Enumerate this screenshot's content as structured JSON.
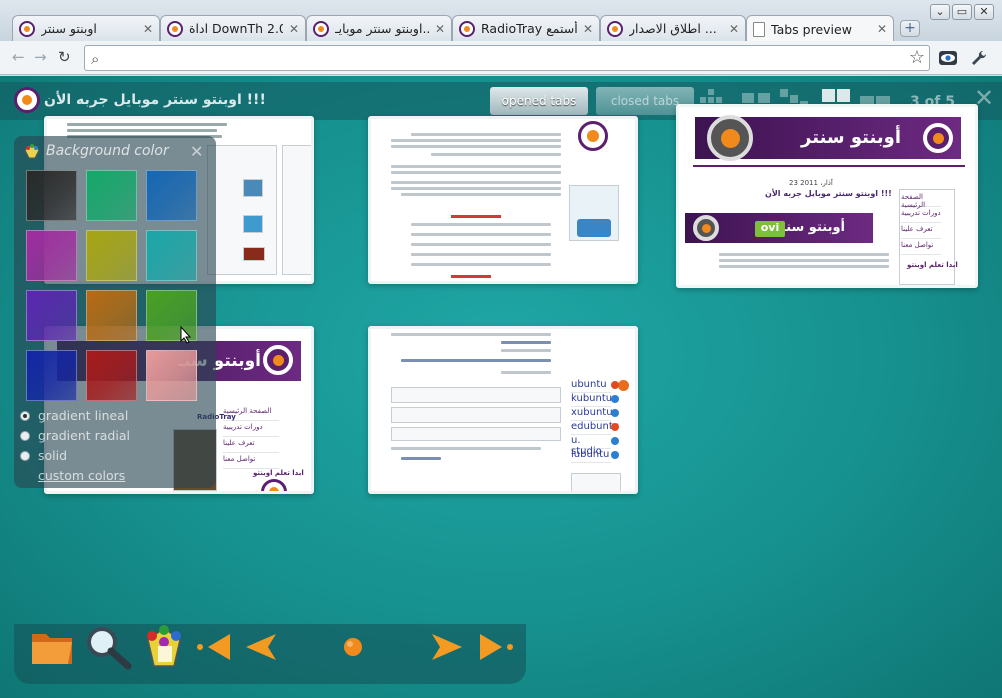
{
  "window": {
    "controls": [
      "⌄",
      "▭",
      "✕"
    ]
  },
  "tabs": [
    {
      "title": "اوبنتو سنتر",
      "active": false
    },
    {
      "title": "اداة DownTh 2.0...",
      "active": false
    },
    {
      "title": "اوبنتو سنتر موبايـ...",
      "active": false
    },
    {
      "title": "RadioTray أستمع...",
      "active": false
    },
    {
      "title": "اطلاق الاصدار ...",
      "active": false
    },
    {
      "title": "Tabs preview",
      "active": true
    }
  ],
  "tab_close": "✕",
  "new_tab": "+",
  "toolbar": {
    "back": "←",
    "forward": "→",
    "reload": "↻",
    "address_value": "",
    "address_placeholder": "",
    "star": "☆"
  },
  "preview": {
    "page_title": "!!! اوبنتو سنتر موبايل جربه الأن",
    "opened_tabs": "opened tabs",
    "closed_tabs": "closed tabs",
    "counter": "3 of 5",
    "close": "✕"
  },
  "thumbs": {
    "t3_banner": "أوبنتو سنتر",
    "t3_banner2": "أوبنتو سنتر",
    "t3_ovi": "ovi",
    "t4_banner": "أوبنتو سنـ",
    "t3_side": [
      "الصفحة الرئيسية",
      "دورات تدريبية",
      "تعرف علينا",
      "تواصل معنا"
    ],
    "t3_headline": "اوبنتو سنتر موبايل جربه الأن !!!",
    "t3_date": "23 آذار، 2011",
    "t3_cta": "ابدا تعلم اوبنتو",
    "t4_side": [
      "الصفحة الرئيسية",
      "دورات تدريبية",
      "تعرف علينا",
      "تواصل معنا"
    ],
    "t4_cta": "ابدا تعلم اوبنتو",
    "t4_radio": "RadioTray",
    "distros": [
      "ubuntu",
      "kubuntu",
      "xubuntu",
      "edubuntu",
      "u. studio",
      "lubuntu"
    ]
  },
  "color_panel": {
    "title": "Background color",
    "close": "✕",
    "swatches": [
      "#2a2a2a",
      "#14a86a",
      "#1567b3",
      "#a12ca0",
      "#a7a512",
      "#1aa7a8",
      "#5b27b1",
      "#b86b13",
      "#4aa123",
      "#1426a6",
      "#a81b1b",
      "#e89a9a"
    ],
    "options": [
      {
        "label": "gradient lineal",
        "selected": true
      },
      {
        "label": "gradient radial",
        "selected": false
      },
      {
        "label": "solid",
        "selected": false
      }
    ],
    "custom": "custom colors"
  },
  "dock": {
    "items": [
      "folder-icon",
      "search-icon",
      "color-palette-icon",
      "first-icon",
      "previous-icon",
      "page-indicator-icon",
      "next-icon",
      "last-icon"
    ]
  },
  "colors": {
    "accent": "#1fa7a6",
    "brand_purple": "#5b1f6d",
    "brand_orange": "#f08a1c"
  }
}
